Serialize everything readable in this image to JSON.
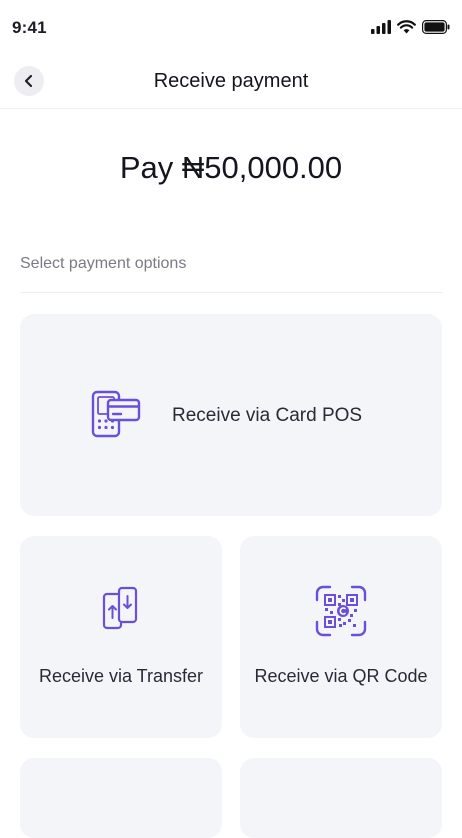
{
  "status_bar": {
    "time": "9:41"
  },
  "header": {
    "title": "Receive payment"
  },
  "payment": {
    "amount_text": "Pay ₦50,000.00"
  },
  "options": {
    "section_label": "Select payment options",
    "card_pos": {
      "label": "Receive via Card POS",
      "icon": "card-pos-icon"
    },
    "transfer": {
      "label": "Receive via Transfer",
      "icon": "transfer-phones-icon"
    },
    "qr": {
      "label": "Receive via QR Code",
      "icon": "qr-code-icon"
    }
  },
  "colors": {
    "accent": "#6b4fd8",
    "card_bg": "#f4f5f9",
    "divider": "#ececf1"
  }
}
